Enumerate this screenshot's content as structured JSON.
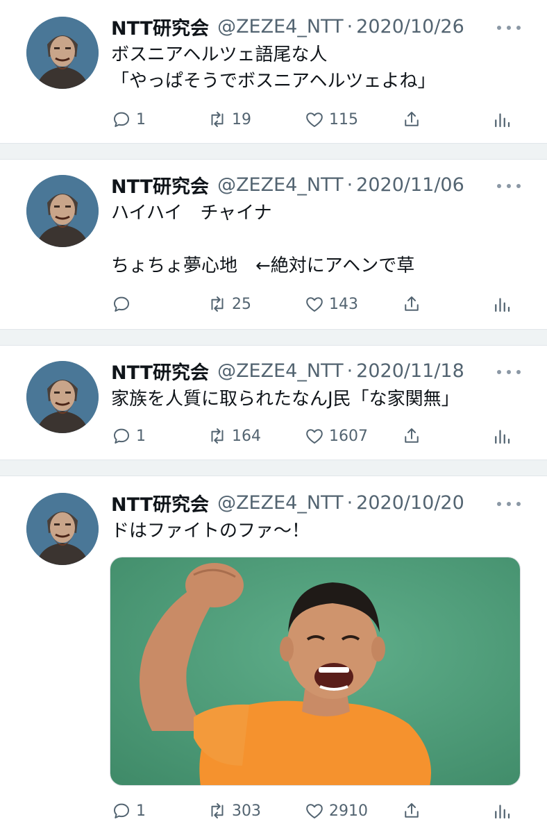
{
  "tweets": [
    {
      "name": "NTT研究会",
      "handle": "@ZEZE4_NTT",
      "sep": "·",
      "date": "2020/10/26",
      "text": "ボスニアヘルツェ語尾な人\n「やっぱそうでボスニアヘルツェよね」",
      "replies": "1",
      "retweets": "19",
      "likes": "115"
    },
    {
      "name": "NTT研究会",
      "handle": "@ZEZE4_NTT",
      "sep": "·",
      "date": "2020/11/06",
      "text": "ハイハイ　チャイナ\n\nちょちょ夢心地　←絶対にアヘンで草",
      "replies": "",
      "retweets": "25",
      "likes": "143"
    },
    {
      "name": "NTT研究会",
      "handle": "@ZEZE4_NTT",
      "sep": "·",
      "date": "2020/11/18",
      "text": "家族を人質に取られたなんJ民「な家関無」",
      "replies": "1",
      "retweets": "164",
      "likes": "1607"
    },
    {
      "name": "NTT研究会",
      "handle": "@ZEZE4_NTT",
      "sep": "·",
      "date": "2020/10/20",
      "text": "ドはファイトのファ〜！",
      "replies": "1",
      "retweets": "303",
      "likes": "2910"
    }
  ],
  "icons": {
    "more": "more-horizontal-icon",
    "reply": "reply-bubble-icon",
    "retweet": "retweet-arrows-icon",
    "like": "heart-icon",
    "share": "share-upload-icon",
    "stats": "bar-stats-icon"
  },
  "colors": {
    "text": "#0f1419",
    "secondary": "#536471",
    "separator": "#eff3f4",
    "media_background": "#4f9a78",
    "shirt": "#f5922e"
  }
}
